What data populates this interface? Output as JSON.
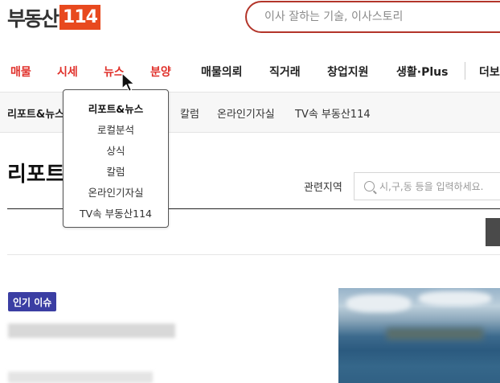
{
  "header": {
    "logo_text": "부동산",
    "logo_box": "114",
    "search_placeholder": "이사 잘하는 기술, 이사스토리"
  },
  "main_nav": {
    "items": [
      {
        "label": "매물"
      },
      {
        "label": "시세"
      },
      {
        "label": "뉴스"
      },
      {
        "label": "분양"
      },
      {
        "label": "매물의뢰"
      },
      {
        "label": "직거래"
      },
      {
        "label": "창업지원"
      },
      {
        "label": "생활·Plus"
      },
      {
        "label": "더보"
      }
    ]
  },
  "sub_nav": {
    "items": [
      {
        "label": "리포트&뉴스"
      },
      {
        "label": "칼럼"
      },
      {
        "label": "온라인기자실"
      },
      {
        "label": "TV속 부동산114"
      }
    ]
  },
  "dropdown": {
    "items": [
      {
        "label": "리포트&뉴스"
      },
      {
        "label": "로컬분석"
      },
      {
        "label": "상식"
      },
      {
        "label": "칼럼"
      },
      {
        "label": "온라인기자실"
      },
      {
        "label": "TV속 부동산114"
      }
    ]
  },
  "page": {
    "title": "리포트",
    "region_label": "관련지역",
    "region_placeholder": "시,구,동 등을 입력하세요."
  },
  "content": {
    "badge": "인기 이슈"
  },
  "colors": {
    "brand": "#e8491e",
    "nav_red": "#e0302a",
    "badge": "#3b3ea3",
    "search_border": "#b3352a"
  }
}
